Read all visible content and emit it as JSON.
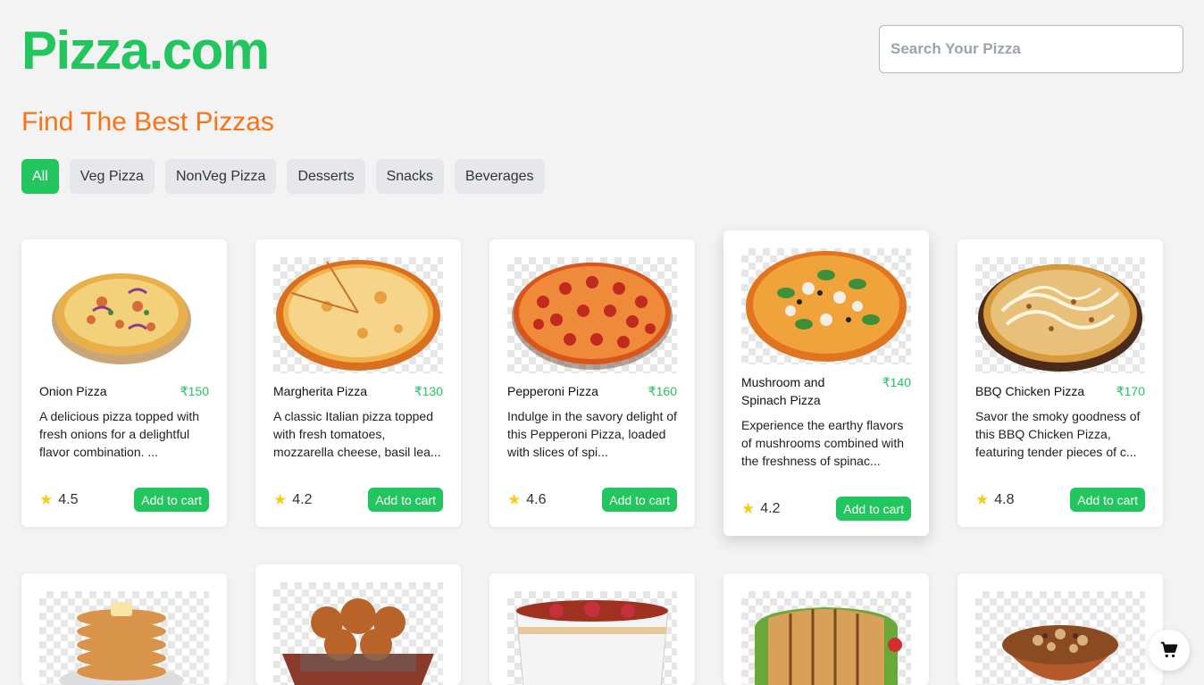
{
  "header": {
    "logo": "Pizza.com",
    "search_placeholder": "Search Your Pizza"
  },
  "headline": "Find The Best Pizzas",
  "filters": [
    "All",
    "Veg Pizza",
    "NonVeg Pizza",
    "Desserts",
    "Snacks",
    "Beverages"
  ],
  "active_filter": "All",
  "products": [
    {
      "name": "Onion Pizza",
      "price": "₹150",
      "description": "A delicious pizza topped with fresh onions for a delightful flavor combination. ...",
      "rating": "4.5",
      "add_label": "Add to cart",
      "image": "onion-pizza"
    },
    {
      "name": "Margherita Pizza",
      "price": "₹130",
      "description": "A classic Italian pizza topped with fresh tomatoes, mozzarella cheese, basil lea...",
      "rating": "4.2",
      "add_label": "Add to cart",
      "image": "margherita-pizza"
    },
    {
      "name": "Pepperoni Pizza",
      "price": "₹160",
      "description": "Indulge in the savory delight of this Pepperoni Pizza, loaded with slices of spi...",
      "rating": "4.6",
      "add_label": "Add to cart",
      "image": "pepperoni-pizza"
    },
    {
      "name": "Mushroom and Spinach Pizza",
      "price": "₹140",
      "description": "Experience the earthy flavors of mushrooms combined with the freshness of spinac...",
      "rating": "4.2",
      "add_label": "Add to cart",
      "image": "mushroom-spinach-pizza"
    },
    {
      "name": "BBQ Chicken Pizza",
      "price": "₹170",
      "description": "Savor the smoky goodness of this BBQ Chicken Pizza, featuring tender pieces of c...",
      "rating": "4.8",
      "add_label": "Add to cart",
      "image": "bbq-chicken-pizza"
    }
  ],
  "second_row_images": [
    "pancakes",
    "pastry-basket",
    "yogurt-parfait",
    "toasted-sandwich",
    "granola-bowl"
  ],
  "cart_icon": "cart-icon",
  "colors": {
    "brand": "#22c55e",
    "accent": "#f97316",
    "star": "#facc15"
  }
}
